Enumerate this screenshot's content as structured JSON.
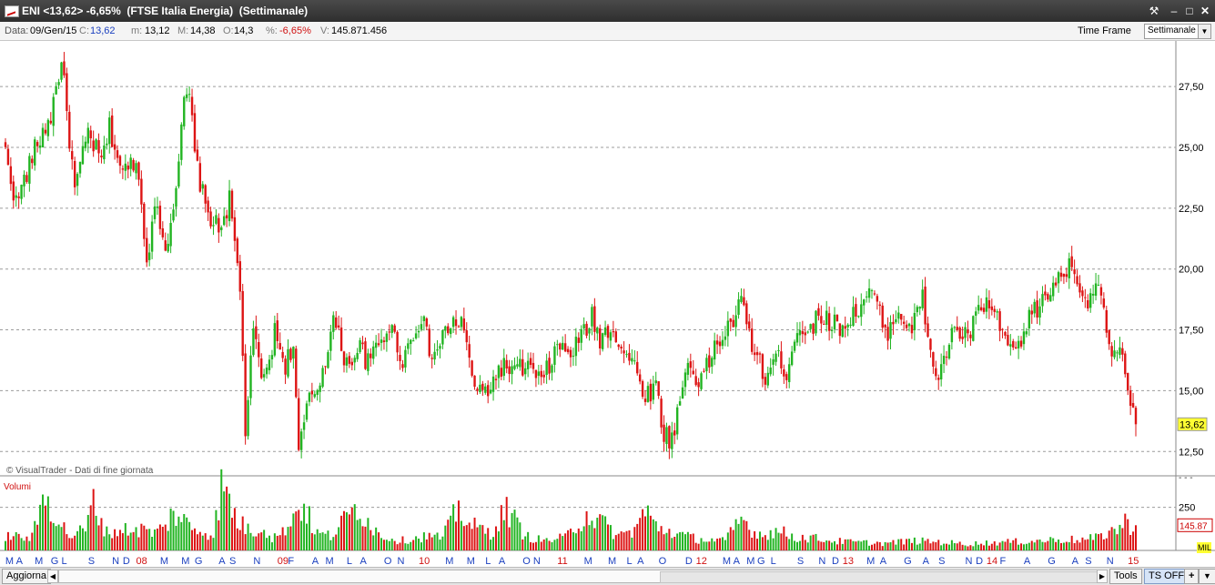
{
  "window": {
    "title": "ENI <13,62> -6,65%  (FTSE Italia Energia)  (Settimanale)",
    "tools_icon": "wrench-icon",
    "minimize_icon": "minimize-icon",
    "maximize_icon": "maximize-icon",
    "close_icon": "close-icon"
  },
  "info": {
    "date_label": "Data:",
    "date_value": "09/Gen/15",
    "close_label": "C:",
    "close_value": "13,62",
    "min_label": "m:",
    "min_value": "13,12",
    "max_label": "M:",
    "max_value": "14,38",
    "open_label": "O:",
    "open_value": "14,3",
    "pct_label": "%:",
    "pct_value": "-6,65%",
    "vol_label": "V:",
    "vol_value": "145.871.456",
    "timeframe_label": "Time Frame",
    "timeframe_value": "Settimanale"
  },
  "chart_data": {
    "type": "candlestick",
    "frequency": "weekly",
    "copyright": "© VisualTrader - Dati di fine giornata",
    "volume_label": "Volumi",
    "price_axis": {
      "ticks": [
        "27,50",
        "25,00",
        "22,50",
        "20,00",
        "17,50",
        "15,00",
        "12,50"
      ],
      "tick_values": [
        27.5,
        25,
        22.5,
        20,
        17.5,
        15,
        12.5
      ],
      "range": [
        11.5,
        29.3
      ],
      "last_price": "13,62"
    },
    "volume_axis": {
      "ticks": [
        "250"
      ],
      "tick_values": [
        250
      ],
      "separator": "- - -",
      "last_volume": "145.87",
      "unit": "MIL",
      "max": 390
    },
    "months": [
      {
        "t": "M",
        "w": 1
      },
      {
        "t": "A",
        "w": 5
      },
      {
        "t": "M",
        "w": 12
      },
      {
        "t": "G",
        "w": 18
      },
      {
        "t": "L",
        "w": 22
      },
      {
        "t": "S",
        "w": 32
      },
      {
        "t": "N",
        "w": 41
      },
      {
        "t": "D",
        "w": 45
      },
      {
        "t": "08",
        "w": 50,
        "year": true
      },
      {
        "t": "M",
        "w": 59
      },
      {
        "t": "M",
        "w": 67
      },
      {
        "t": "G",
        "w": 72
      },
      {
        "t": "A",
        "w": 81
      },
      {
        "t": "S",
        "w": 85
      },
      {
        "t": "N",
        "w": 94
      },
      {
        "t": "09",
        "w": 103,
        "year": true
      },
      {
        "t": "F",
        "w": 107
      },
      {
        "t": "A",
        "w": 116
      },
      {
        "t": "M",
        "w": 121
      },
      {
        "t": "L",
        "w": 129
      },
      {
        "t": "A",
        "w": 134
      },
      {
        "t": "O",
        "w": 143
      },
      {
        "t": "N",
        "w": 148
      },
      {
        "t": "10",
        "w": 156,
        "year": true
      },
      {
        "t": "M",
        "w": 166
      },
      {
        "t": "M",
        "w": 174
      },
      {
        "t": "L",
        "w": 181
      },
      {
        "t": "A",
        "w": 186
      },
      {
        "t": "O",
        "w": 195
      },
      {
        "t": "N",
        "w": 199
      },
      {
        "t": "11",
        "w": 208,
        "year": true
      },
      {
        "t": "M",
        "w": 218
      },
      {
        "t": "M",
        "w": 227
      },
      {
        "t": "L",
        "w": 234
      },
      {
        "t": "A",
        "w": 238
      },
      {
        "t": "O",
        "w": 246
      },
      {
        "t": "D",
        "w": 256
      },
      {
        "t": "12",
        "w": 260,
        "year": true
      },
      {
        "t": "M",
        "w": 270
      },
      {
        "t": "A",
        "w": 274
      },
      {
        "t": "M",
        "w": 279
      },
      {
        "t": "G",
        "w": 283
      },
      {
        "t": "L",
        "w": 288
      },
      {
        "t": "S",
        "w": 298
      },
      {
        "t": "N",
        "w": 306
      },
      {
        "t": "D",
        "w": 311
      },
      {
        "t": "13",
        "w": 315,
        "year": true
      },
      {
        "t": "M",
        "w": 324
      },
      {
        "t": "A",
        "w": 329
      },
      {
        "t": "G",
        "w": 338
      },
      {
        "t": "A",
        "w": 345
      },
      {
        "t": "S",
        "w": 351
      },
      {
        "t": "N",
        "w": 361
      },
      {
        "t": "D",
        "w": 365
      },
      {
        "t": "14",
        "w": 369,
        "year": true
      },
      {
        "t": "F",
        "w": 374
      },
      {
        "t": "A",
        "w": 383
      },
      {
        "t": "G",
        "w": 392
      },
      {
        "t": "A",
        "w": 401
      },
      {
        "t": "S",
        "w": 406
      },
      {
        "t": "N",
        "w": 414
      },
      {
        "t": "15",
        "w": 422,
        "year": true
      }
    ],
    "anchors": [
      [
        0,
        24.8
      ],
      [
        4,
        22.7
      ],
      [
        11,
        24.9
      ],
      [
        17,
        26.3
      ],
      [
        21,
        28.6
      ],
      [
        26,
        23.2
      ],
      [
        31,
        25.6
      ],
      [
        36,
        24.4
      ],
      [
        39,
        25.8
      ],
      [
        44,
        23.9
      ],
      [
        49,
        24.6
      ],
      [
        53,
        20.6
      ],
      [
        57,
        22.7
      ],
      [
        60,
        20.7
      ],
      [
        64,
        23.5
      ],
      [
        67,
        26.7
      ],
      [
        69,
        27.2
      ],
      [
        71,
        24.7
      ],
      [
        75,
        22.5
      ],
      [
        80,
        21.6
      ],
      [
        84,
        22.8
      ],
      [
        88,
        19.2
      ],
      [
        90,
        13.4
      ],
      [
        93,
        17.3
      ],
      [
        97,
        15.3
      ],
      [
        101,
        17.4
      ],
      [
        105,
        16.1
      ],
      [
        108,
        16.9
      ],
      [
        110,
        12.3
      ],
      [
        113,
        14.3
      ],
      [
        118,
        15.4
      ],
      [
        123,
        17.9
      ],
      [
        128,
        16.1
      ],
      [
        133,
        16.8
      ],
      [
        136,
        16.1
      ],
      [
        144,
        17.7
      ],
      [
        149,
        16.3
      ],
      [
        156,
        18.1
      ],
      [
        160,
        16.3
      ],
      [
        166,
        17.6
      ],
      [
        171,
        17.9
      ],
      [
        175,
        15.6
      ],
      [
        178,
        14.8
      ],
      [
        182,
        15.2
      ],
      [
        186,
        16.0
      ],
      [
        191,
        15.8
      ],
      [
        196,
        16.0
      ],
      [
        201,
        15.3
      ],
      [
        207,
        16.8
      ],
      [
        212,
        16.5
      ],
      [
        217,
        17.4
      ],
      [
        220,
        18.0
      ],
      [
        223,
        17.1
      ],
      [
        227,
        17.7
      ],
      [
        232,
        16.6
      ],
      [
        236,
        16.0
      ],
      [
        240,
        14.8
      ],
      [
        244,
        15.2
      ],
      [
        247,
        13.2
      ],
      [
        250,
        13.0
      ],
      [
        253,
        14.6
      ],
      [
        256,
        16.2
      ],
      [
        260,
        15.4
      ],
      [
        263,
        15.9
      ],
      [
        266,
        16.8
      ],
      [
        271,
        17.5
      ],
      [
        276,
        18.6
      ],
      [
        281,
        16.6
      ],
      [
        285,
        15.5
      ],
      [
        289,
        16.4
      ],
      [
        293,
        15.8
      ],
      [
        297,
        17.6
      ],
      [
        302,
        17.5
      ],
      [
        306,
        18.2
      ],
      [
        310,
        17.7
      ],
      [
        315,
        17.7
      ],
      [
        320,
        18.4
      ],
      [
        323,
        18.9
      ],
      [
        326,
        18.9
      ],
      [
        330,
        17.3
      ],
      [
        335,
        18.3
      ],
      [
        340,
        17.5
      ],
      [
        344,
        18.8
      ],
      [
        348,
        15.8
      ],
      [
        351,
        15.7
      ],
      [
        355,
        17.5
      ],
      [
        361,
        17.2
      ],
      [
        365,
        18.2
      ],
      [
        368,
        18.6
      ],
      [
        371,
        18.2
      ],
      [
        374,
        17.1
      ],
      [
        377,
        16.8
      ],
      [
        380,
        16.6
      ],
      [
        384,
        18.1
      ],
      [
        389,
        18.6
      ],
      [
        394,
        19.5
      ],
      [
        398,
        20.1
      ],
      [
        402,
        19.8
      ],
      [
        405,
        18.6
      ],
      [
        409,
        19.5
      ],
      [
        412,
        18.0
      ],
      [
        415,
        16.5
      ],
      [
        418,
        16.5
      ],
      [
        420,
        15.8
      ],
      [
        422,
        14.1
      ],
      [
        424,
        13.62
      ]
    ],
    "volume_anchors": [
      [
        0,
        90
      ],
      [
        10,
        80
      ],
      [
        15,
        360
      ],
      [
        19,
        210
      ],
      [
        24,
        90
      ],
      [
        30,
        130
      ],
      [
        33,
        300
      ],
      [
        38,
        110
      ],
      [
        44,
        130
      ],
      [
        52,
        130
      ],
      [
        56,
        110
      ],
      [
        60,
        150
      ],
      [
        63,
        240
      ],
      [
        70,
        140
      ],
      [
        78,
        100
      ],
      [
        81,
        390
      ],
      [
        83,
        350
      ],
      [
        87,
        180
      ],
      [
        93,
        110
      ],
      [
        96,
        160
      ],
      [
        100,
        80
      ],
      [
        104,
        110
      ],
      [
        107,
        200
      ],
      [
        112,
        290
      ],
      [
        116,
        110
      ],
      [
        122,
        90
      ],
      [
        132,
        280
      ],
      [
        140,
        100
      ],
      [
        148,
        60
      ],
      [
        158,
        90
      ],
      [
        164,
        80
      ],
      [
        170,
        270
      ],
      [
        174,
        160
      ],
      [
        182,
        110
      ],
      [
        188,
        260
      ],
      [
        195,
        90
      ],
      [
        202,
        60
      ],
      [
        210,
        80
      ],
      [
        218,
        230
      ],
      [
        224,
        170
      ],
      [
        230,
        90
      ],
      [
        236,
        130
      ],
      [
        240,
        250
      ],
      [
        244,
        150
      ],
      [
        249,
        120
      ],
      [
        255,
        90
      ],
      [
        260,
        70
      ],
      [
        270,
        60
      ],
      [
        276,
        200
      ],
      [
        282,
        100
      ],
      [
        290,
        120
      ],
      [
        297,
        80
      ],
      [
        302,
        80
      ],
      [
        310,
        60
      ],
      [
        320,
        50
      ],
      [
        330,
        45
      ],
      [
        340,
        60
      ],
      [
        349,
        55
      ],
      [
        360,
        40
      ],
      [
        372,
        50
      ],
      [
        380,
        55
      ],
      [
        388,
        60
      ],
      [
        396,
        70
      ],
      [
        404,
        65
      ],
      [
        410,
        80
      ],
      [
        414,
        120
      ],
      [
        418,
        140
      ],
      [
        420,
        175
      ],
      [
        424,
        146
      ]
    ],
    "n_weeks": 425
  },
  "footer": {
    "update_button": "Aggiorna",
    "tools_label": "Tools",
    "ts_label": "TS OFF",
    "plus_label": "+",
    "scroll_left_icon": "scroll-left-icon",
    "scroll_right_icon": "scroll-right-icon"
  },
  "colors": {
    "up": "#22b422",
    "down": "#dd1414",
    "month_letter": "#1a3fbf",
    "year_label": "#d01010",
    "last_price_bg": "#ffff33",
    "grid": "#9c9c9c"
  }
}
